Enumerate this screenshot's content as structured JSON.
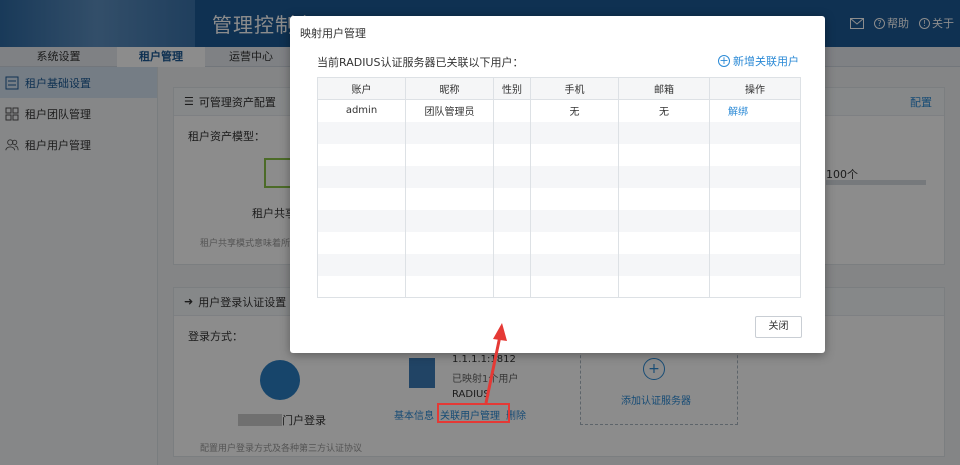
{
  "header": {
    "title": "管理控制台",
    "mail_icon": "mail-icon",
    "help_label": "帮助",
    "about_label": "关于"
  },
  "nav": {
    "tabs": [
      {
        "label": "系统设置"
      },
      {
        "label": "租户管理",
        "active": true
      },
      {
        "label": "运营中心"
      }
    ]
  },
  "sidebar": {
    "items": [
      {
        "label": "租户基础设置",
        "icon": "list-icon",
        "active": true
      },
      {
        "label": "租户团队管理",
        "icon": "grid-icon"
      },
      {
        "label": "租户用户管理",
        "icon": "users-icon"
      }
    ]
  },
  "asset_card": {
    "title": "可管理资产配置",
    "config_link": "配置",
    "model_label": "租户资产模型：",
    "model_name": "租户共享",
    "note": "租户共享模式意味着所",
    "quota_text": "100个"
  },
  "auth_card": {
    "title": "用户登录认证设置",
    "method_label": "登录方式：",
    "portal_label": "门户登录",
    "server_ip": "1.1.1.1:1812",
    "server_mapped": "已映射1个用户",
    "server_type": "RADIUS",
    "actions": [
      "基本信息",
      "关联用户管理",
      "删除"
    ],
    "add_server": "添加认证服务器",
    "note": "配置用户登录方式及各种第三方认证协议"
  },
  "modal": {
    "title": "映射用户管理",
    "subtitle": "当前RADIUS认证服务器已关联以下用户：",
    "add_link": "新增关联用户",
    "columns": [
      "账户",
      "昵称",
      "性别",
      "手机",
      "邮箱",
      "操作"
    ],
    "rows": [
      {
        "account": "admin",
        "nickname": "团队管理员",
        "gender": "",
        "phone": "无",
        "email": "无",
        "action": "解绑"
      }
    ],
    "empty_rows": 8,
    "close_label": "关闭"
  },
  "colors": {
    "header_bg": "#1c5a96",
    "link": "#2b8ad6",
    "highlight": "#e53935"
  }
}
